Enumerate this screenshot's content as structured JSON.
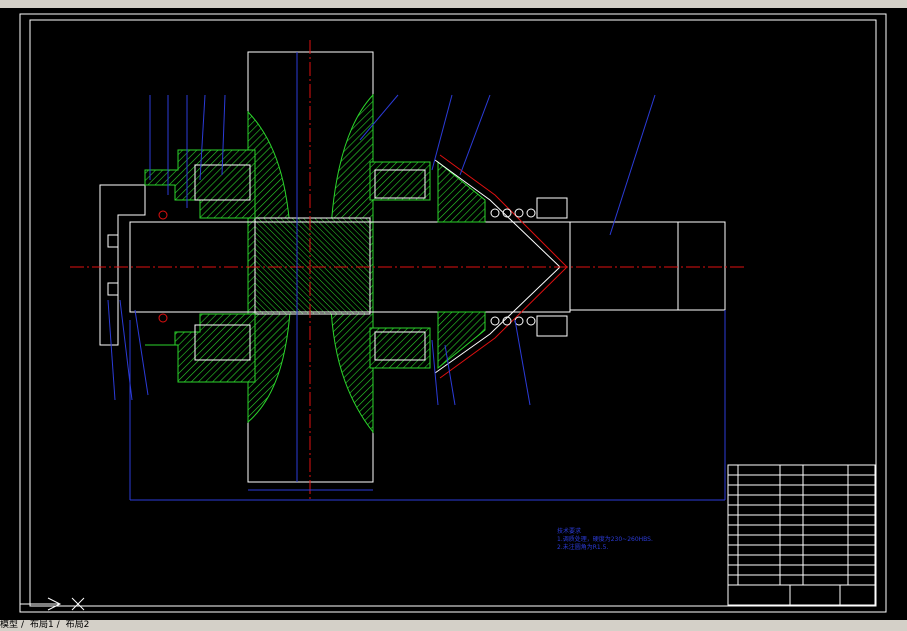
{
  "window": {
    "tabs": [
      "模型",
      "布局1",
      "布局2"
    ],
    "tab_separator": "/"
  },
  "drawing": {
    "notes": {
      "title": "技术要求",
      "lines": [
        "1.调质处理，硬度为230~260HBS.",
        "2.未注圆角为R1.5."
      ]
    },
    "colors": {
      "background": "#000000",
      "outline": "#ffffff",
      "hatch": "#2bd42b",
      "centerline": "#e01010",
      "leader": "#2b3bd8",
      "ui_gray": "#d4d0c8"
    }
  }
}
